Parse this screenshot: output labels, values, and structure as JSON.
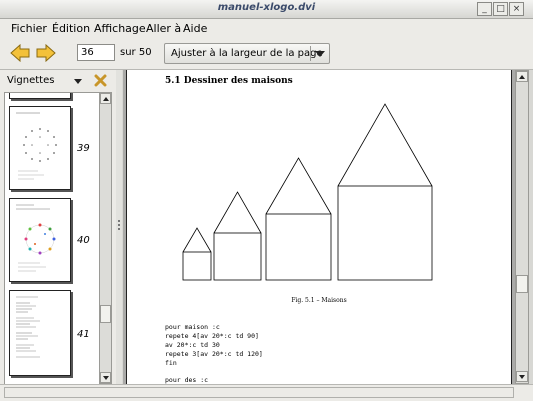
{
  "window": {
    "title": "manuel-xlogo.dvi",
    "buttons": {
      "minimize": "_",
      "maximize": "□",
      "close": "×"
    }
  },
  "menubar": {
    "items": [
      {
        "label": "Fichier"
      },
      {
        "label": "Édition"
      },
      {
        "label": "Affichage"
      },
      {
        "label": "Aller à"
      },
      {
        "label": "Aide"
      }
    ]
  },
  "toolbar": {
    "back_icon": "arrow-left-icon",
    "forward_icon": "arrow-right-icon",
    "page_value": "36",
    "of_label": "sur 50",
    "zoom_label": "Ajuster à la largeur de la page"
  },
  "sidebar": {
    "title": "Vignettes",
    "close_icon": "close-icon",
    "thumbnails": [
      {
        "page": "39"
      },
      {
        "page": "40"
      },
      {
        "page": "41"
      }
    ]
  },
  "document": {
    "section_title": "5.1    Dessiner des maisons",
    "figure_caption": "Fig. 5.1 – Maisons",
    "code_lines": [
      "pour maison :c",
      "repete 4[av 20*:c td 90]",
      "av 20*:c td 30",
      "repete 3[av 20*:c td 120]",
      "fin",
      "",
      "pour des :c"
    ]
  },
  "colors": {
    "arrow_fill": "#f3c13a",
    "close_icon": "#c8962a",
    "title_text": "#3a4a6a"
  }
}
